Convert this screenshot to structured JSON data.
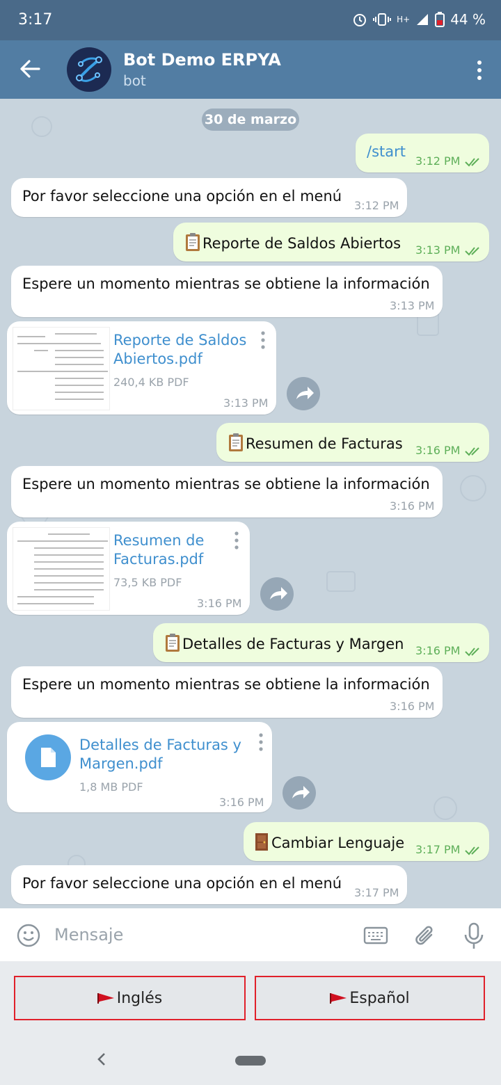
{
  "status_bar": {
    "time": "3:17",
    "network": "H+",
    "battery": "44 %"
  },
  "header": {
    "title": "Bot Demo ERPYA",
    "subtitle": "bot"
  },
  "chat": {
    "date": "30 de marzo",
    "messages": [
      {
        "text": "/start",
        "time": "3:12 PM"
      },
      {
        "text": "Por favor seleccione una opción en el menú",
        "time": "3:12 PM"
      },
      {
        "text": "Reporte de Saldos Abiertos",
        "time": "3:13 PM"
      },
      {
        "text": "Espere un momento mientras se obtiene la información",
        "time": "3:13 PM"
      },
      {
        "line1": "Reporte de Saldos",
        "line2": "Abiertos.pdf",
        "size": "240,4 KB PDF",
        "time": "3:13 PM"
      },
      {
        "text": "Resumen de Facturas",
        "time": "3:16 PM"
      },
      {
        "text": "Espere un momento mientras se obtiene la información",
        "time": "3:16 PM"
      },
      {
        "line1": "Resumen de",
        "line2": "Facturas.pdf",
        "size": "73,5 KB PDF",
        "time": "3:16 PM"
      },
      {
        "text": "Detalles de Facturas y Margen",
        "time": "3:16 PM"
      },
      {
        "text": "Espere un momento mientras se obtiene la información",
        "time": "3:16 PM"
      },
      {
        "line1": "Detalles de Facturas y",
        "line2": "Margen.pdf",
        "size": "1,8 MB PDF",
        "time": "3:16 PM"
      },
      {
        "text": "Cambiar Lenguaje",
        "time": "3:17 PM"
      },
      {
        "text": "Por favor seleccione una opción en el menú",
        "time": "3:17 PM"
      }
    ]
  },
  "input": {
    "placeholder": "Mensaje"
  },
  "keyboard": {
    "buttons": [
      "Inglés",
      "Español"
    ]
  },
  "colors": {
    "header": "#527da3",
    "outgoing": "#effdde",
    "incoming": "#ffffff",
    "link": "#3f8fce",
    "accent_border": "#e0202a"
  }
}
